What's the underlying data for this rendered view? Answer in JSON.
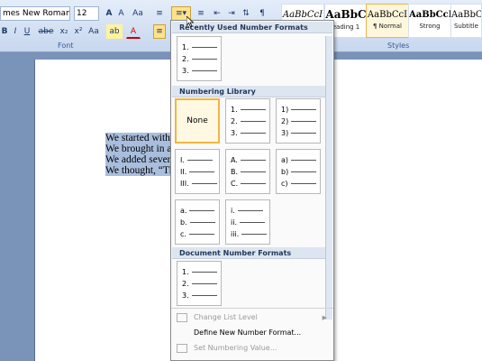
{
  "font": {
    "name": "mes New Roman",
    "size": "12",
    "grow_label": "A",
    "shrink_label": "A",
    "clear_label": "Aa",
    "bold": "B",
    "italic": "I",
    "underline": "U",
    "strike": "abe",
    "sub": "x₂",
    "sup": "x²",
    "case": "Aa",
    "highlight": "ab",
    "color": "A",
    "group_label": "Font"
  },
  "styles": {
    "group_label": "Styles",
    "items": [
      {
        "sample": "AaBbCcI",
        "name": ""
      },
      {
        "sample": "AaBbC",
        "name": "eading 1"
      },
      {
        "sample": "AaBbCcI",
        "name": "¶ Normal"
      },
      {
        "sample": "AaBbCcI",
        "name": "Strong"
      },
      {
        "sample": "AaBbCc",
        "name": "Subtitle"
      }
    ]
  },
  "document": {
    "lines": [
      "We started with a",
      "We brought in a c",
      "We added several",
      "We thought, “Thi"
    ]
  },
  "numbering_dropdown": {
    "recent_header": "Recently Used Number Formats",
    "library_header": "Numbering Library",
    "document_header": "Document Number Formats",
    "none_label": "None",
    "formats": {
      "decimal_dot": [
        "1.",
        "2.",
        "3."
      ],
      "decimal_paren": [
        "1)",
        "2)",
        "3)"
      ],
      "roman_upper": [
        "I.",
        "II.",
        "III."
      ],
      "alpha_upper": [
        "A.",
        "B.",
        "C."
      ],
      "alpha_lower_paren": [
        "a)",
        "b)",
        "c)"
      ],
      "alpha_lower": [
        "a.",
        "b.",
        "c."
      ],
      "roman_lower": [
        "i.",
        "ii.",
        "iii."
      ]
    },
    "menu": {
      "change_level": "Change List Level",
      "define_new": "Define New Number Format...",
      "set_value": "Set Numbering Value..."
    }
  }
}
